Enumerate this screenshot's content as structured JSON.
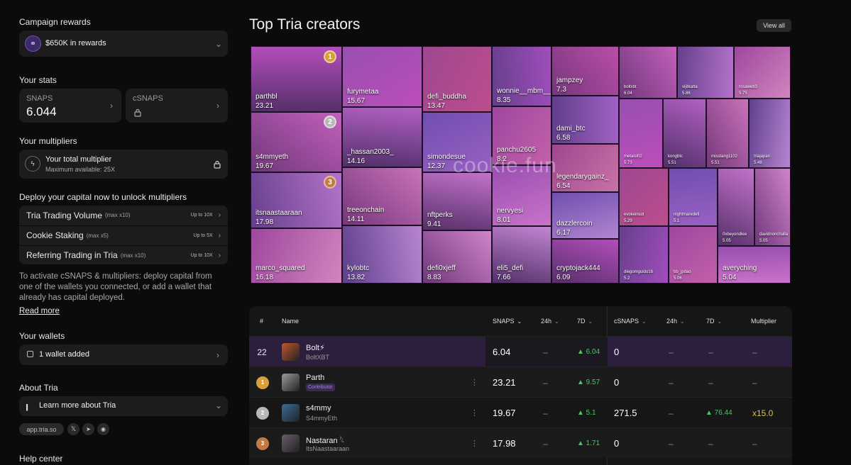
{
  "sidebar": {
    "campaign_heading": "Campaign rewards",
    "campaign_value": "$650K in rewards",
    "stats_heading": "Your stats",
    "snaps_label": "SNAPS",
    "snaps_value": "6.044",
    "csnaps_label": "cSNAPS",
    "multipliers_heading": "Your multipliers",
    "total_multiplier": "Your total multiplier",
    "max_available": "Maximum available: 25X",
    "deploy_heading": "Deploy your capital now to unlock multipliers",
    "deploy_rows": [
      {
        "label": "Tria Trading Volume",
        "max": "(max x10)",
        "upto": "Up to 10X"
      },
      {
        "label": "Cookie Staking",
        "max": "(max x5)",
        "upto": "Up to 5X"
      },
      {
        "label": "Referring Trading in Tria",
        "max": "(max x10)",
        "upto": "Up to 10X"
      }
    ],
    "activate_text": "To activate cSNAPS & multipliers: deploy capital from one of the wallets you connected, or add a wallet that already has capital deployed.",
    "read_more": "Read more",
    "wallets_heading": "Your wallets",
    "wallets_value": "1 wallet added",
    "about_heading": "About Tria",
    "about_value": "Learn more about Tria",
    "site_link": "app.tria.so",
    "help_heading": "Help center"
  },
  "main": {
    "title": "Top Tria creators",
    "view_all": "View all",
    "watermark": "cookie.fun",
    "tiles": [
      {
        "n": "parthbl",
        "v": "23.21"
      },
      {
        "n": "s4mmyeth",
        "v": "19.67"
      },
      {
        "n": "itsnaastaaraan",
        "v": "17.98"
      },
      {
        "n": "marco_squared",
        "v": "16.18"
      },
      {
        "n": "furymetaa",
        "v": "15.67"
      },
      {
        "n": "_hassan2003_",
        "v": "14.16"
      },
      {
        "n": "treeonchain",
        "v": "14.11"
      },
      {
        "n": "kylobtc",
        "v": "13.82"
      },
      {
        "n": "defi_buddha",
        "v": "13.47"
      },
      {
        "n": "simondesue",
        "v": "12.37"
      },
      {
        "n": "nftperks",
        "v": "9.41"
      },
      {
        "n": "defi0xjeff",
        "v": "8.83"
      },
      {
        "n": "wonnie__mbm__",
        "v": "8.35"
      },
      {
        "n": "panchu2605",
        "v": "8.2"
      },
      {
        "n": "nervyesi",
        "v": "8.01"
      },
      {
        "n": "eli5_defi",
        "v": "7.66"
      },
      {
        "n": "jampzey",
        "v": "7.3"
      },
      {
        "n": "dami_btc",
        "v": "6.58"
      },
      {
        "n": "legendarygainz_",
        "v": "6.54"
      },
      {
        "n": "dazzlercoin",
        "v": "6.17"
      },
      {
        "n": "cryptojack444",
        "v": "6.09"
      },
      {
        "n": "boltxbt",
        "v": "6.04"
      },
      {
        "n": "vijitkatta",
        "v": "5.86"
      },
      {
        "n": "rosaweb3",
        "v": "5.75"
      },
      {
        "n": "metaisl02",
        "v": "5.73"
      },
      {
        "n": "kongbtc",
        "v": "5.51"
      },
      {
        "n": "misstang1102",
        "v": "5.51"
      },
      {
        "n": "triajapan",
        "v": "5.48"
      },
      {
        "n": "evokeinsol",
        "v": "5.29"
      },
      {
        "n": "nightmaredefi",
        "v": "5.1"
      },
      {
        "n": "0xbeyondlee",
        "v": "5.05"
      },
      {
        "n": "davidnonchalla",
        "v": "5.05"
      },
      {
        "n": "diegomguido16",
        "v": "5.2"
      },
      {
        "n": "bb_jpdao",
        "v": "5.06"
      },
      {
        "n": "averyching",
        "v": "5.04"
      }
    ],
    "ranks": [
      "1",
      "2",
      "3"
    ],
    "table": {
      "headers": {
        "rank": "#",
        "name": "Name",
        "snaps": "SNAPS",
        "h24": "24h",
        "d7": "7D",
        "csnaps": "cSNAPS",
        "ch24": "24h",
        "cd7": "7D",
        "mult": "Multiplier"
      },
      "rows": [
        {
          "rank": "22",
          "name": "Bolt⚡",
          "handle": "BoltXBT",
          "snaps": "6.04",
          "h24": "–",
          "d7": "▲ 6.04",
          "csnaps": "0",
          "ch24": "–",
          "cd7": "–",
          "mult": "–"
        },
        {
          "rank": "1",
          "name": "Parth",
          "handle": "Contributor",
          "snaps": "23.21",
          "h24": "–",
          "d7": "▲ 9.57",
          "csnaps": "0",
          "ch24": "–",
          "cd7": "–",
          "mult": "–"
        },
        {
          "rank": "2",
          "name": "s4mmy",
          "handle": "S4mmyEth",
          "snaps": "19.67",
          "h24": "–",
          "d7": "▲ 5.1",
          "csnaps": "271.5",
          "ch24": "–",
          "cd7": "▲ 76.44",
          "mult": "x15.0"
        },
        {
          "rank": "3",
          "name": "Nastaran 𓆩",
          "handle": "ItsNaastaaraan",
          "snaps": "17.98",
          "h24": "–",
          "d7": "▲ 1.71",
          "csnaps": "0",
          "ch24": "–",
          "cd7": "–",
          "mult": "–"
        }
      ]
    }
  },
  "colors": {
    "accent": "#7b4fc4",
    "up": "#4ec36a",
    "gold": "#d9a03a",
    "silver": "#b8b8b8",
    "bronze": "#c47a45"
  }
}
